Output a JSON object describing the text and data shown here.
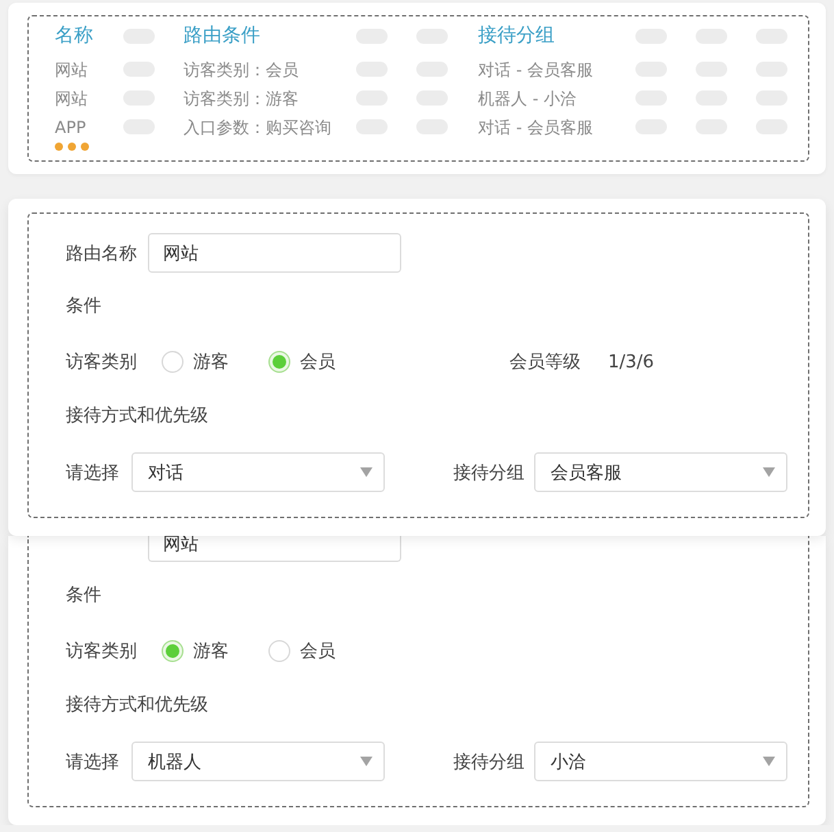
{
  "route_table": {
    "columns": [
      "名称",
      "路由条件",
      "接待分组"
    ],
    "rows": [
      {
        "cells": [
          "网站",
          "访客类别：会员",
          "对话 - 会员客服"
        ]
      },
      {
        "cells": [
          "网站",
          "访客类别：游客",
          "机器人 - 小洽"
        ]
      },
      {
        "cells": [
          "APP",
          "入口参数：购买咨询",
          "对话 - 会员客服"
        ]
      }
    ]
  },
  "route_forms": [
    {
      "name_field": {
        "label": "路由名称",
        "value": "网站"
      },
      "condition_heading": "条件",
      "visitor_type": {
        "label": "访客类别",
        "options": [
          {
            "label": "游客",
            "selected": false
          },
          {
            "label": "会员",
            "selected": true
          }
        ]
      },
      "member_level": {
        "label": "会员等级",
        "value": "1/3/6"
      },
      "reception_heading": "接待方式和优先级",
      "method_select": {
        "label": "请选择",
        "value": "对话"
      },
      "group_select": {
        "label": "接待分组",
        "value": "会员客服"
      }
    },
    {
      "name_field": {
        "value": "网站"
      },
      "condition_heading": "条件",
      "visitor_type": {
        "label": "访客类别",
        "options": [
          {
            "label": "游客",
            "selected": true
          },
          {
            "label": "会员",
            "selected": false
          }
        ]
      },
      "reception_heading": "接待方式和优先级",
      "method_select": {
        "label": "请选择",
        "value": "机器人"
      },
      "group_select": {
        "label": "接待分组",
        "value": "小洽"
      }
    }
  ]
}
